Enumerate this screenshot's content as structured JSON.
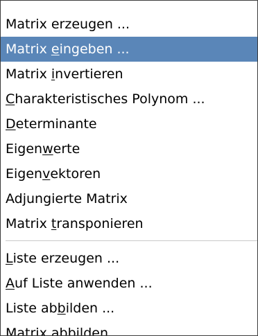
{
  "menu": {
    "items": [
      {
        "pre": "Matrix erzeugen ...",
        "key": "",
        "post": "",
        "selected": false
      },
      {
        "pre": "Matrix ",
        "key": "e",
        "post": "ingeben ...",
        "selected": true
      },
      {
        "pre": "Matrix ",
        "key": "i",
        "post": "nvertieren",
        "selected": false
      },
      {
        "pre": "",
        "key": "C",
        "post": "harakteristisches Polynom ...",
        "selected": false
      },
      {
        "pre": "",
        "key": "D",
        "post": "eterminante",
        "selected": false
      },
      {
        "pre": "Eigen",
        "key": "w",
        "post": "erte",
        "selected": false
      },
      {
        "pre": "Eigen",
        "key": "v",
        "post": "ektoren",
        "selected": false
      },
      {
        "pre": "Adjungierte Matrix",
        "key": "",
        "post": "",
        "selected": false
      },
      {
        "pre": "Matrix ",
        "key": "t",
        "post": "ransponieren",
        "selected": false
      }
    ],
    "items_after_separator": [
      {
        "pre": "",
        "key": "L",
        "post": "iste erzeugen ...",
        "selected": false
      },
      {
        "pre": "",
        "key": "A",
        "post": "uf Liste anwenden ...",
        "selected": false
      },
      {
        "pre": "Liste ab",
        "key": "b",
        "post": "ilden ...",
        "selected": false
      },
      {
        "pre": "",
        "key": "M",
        "post": "atrix abbilden ...",
        "selected": false
      }
    ]
  }
}
